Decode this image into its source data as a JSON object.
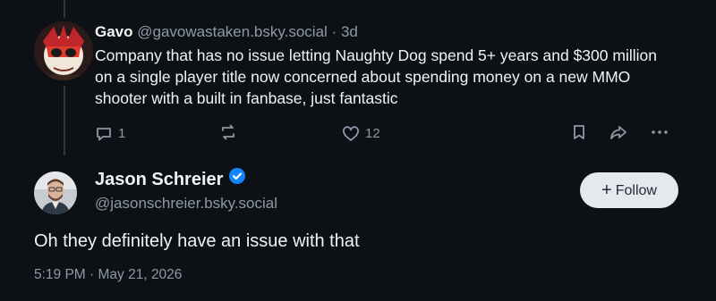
{
  "reply": {
    "author_name": "Gavo",
    "author_handle": "@gavowastaken.bsky.social",
    "separator": "·",
    "time_ago": "3d",
    "text": "Company that has no issue letting Naughty Dog spend 5+ years and $300 million on a single player title now concerned about spending money on a new MMO shooter with a built in fanbase, just fantastic",
    "reply_count": "1",
    "like_count": "12",
    "icons": [
      "reply-icon",
      "repost-icon",
      "like-icon",
      "bookmark-icon",
      "share-icon",
      "more-icon"
    ]
  },
  "post": {
    "author_name": "Jason Schreier",
    "author_handle": "@jasonschreier.bsky.social",
    "verified_icon": "verified-badge-icon",
    "follow_label": "Follow",
    "follow_plus": "+",
    "text": "Oh they definitely have an issue with that",
    "timestamp": "5:19 PM · May 21, 2026"
  },
  "colors": {
    "background": "#0d1116",
    "text_primary": "#f1f3f5",
    "text_secondary": "#8d99a6",
    "verified": "#1185fe",
    "follow_button_bg": "#e5e8ec",
    "thread_line": "#2e3843"
  }
}
